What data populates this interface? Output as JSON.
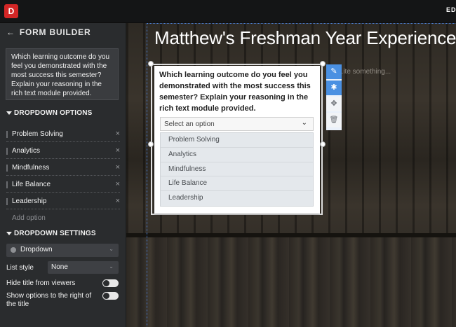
{
  "app": {
    "logo_letter": "D",
    "top_right_label": "ED"
  },
  "sidebar": {
    "header_back": "←",
    "header_title": "FORM BUILDER",
    "question_text": "Which learning outcome do you feel you demonstrated with the most success this semester? Explain your reasoning in the rich text module provided.",
    "dropdown_options_title": "DROPDOWN OPTIONS",
    "options": [
      {
        "label": "Problem Solving"
      },
      {
        "label": "Analytics"
      },
      {
        "label": "Mindfulness"
      },
      {
        "label": "Life Balance"
      },
      {
        "label": "Leadership"
      }
    ],
    "remove_glyph": "×",
    "add_option_label": "Add option",
    "dropdown_settings_title": "DROPDOWN SETTINGS",
    "type_select_value": "Dropdown",
    "list_style_label": "List style",
    "list_style_value": "None",
    "hide_title_label": "Hide title from viewers",
    "show_options_label_line1": "Show options to the right of",
    "show_options_label_line2": "the title",
    "chevron": "⌄"
  },
  "canvas": {
    "page_title": "Matthew's Freshman Year Experience",
    "rich_text_placeholder": "...ite something..."
  },
  "module": {
    "question": "Which learning outcome do you feel you demonstrated with the most success this semester? Explain your reasoning in the rich text module provided.",
    "select_placeholder": "Select an option",
    "chevron": "⌄",
    "items": [
      {
        "label": "Problem Solving"
      },
      {
        "label": "Analytics"
      },
      {
        "label": "Mindfulness"
      },
      {
        "label": "Life Balance"
      },
      {
        "label": "Leadership"
      }
    ],
    "tools": {
      "edit": "✎",
      "settings": "✱",
      "move": "✥",
      "delete": "🗑"
    }
  },
  "colors": {
    "accent": "#4a90e2",
    "brand": "#d32626",
    "sidebar_bg": "#2a2c2e"
  }
}
